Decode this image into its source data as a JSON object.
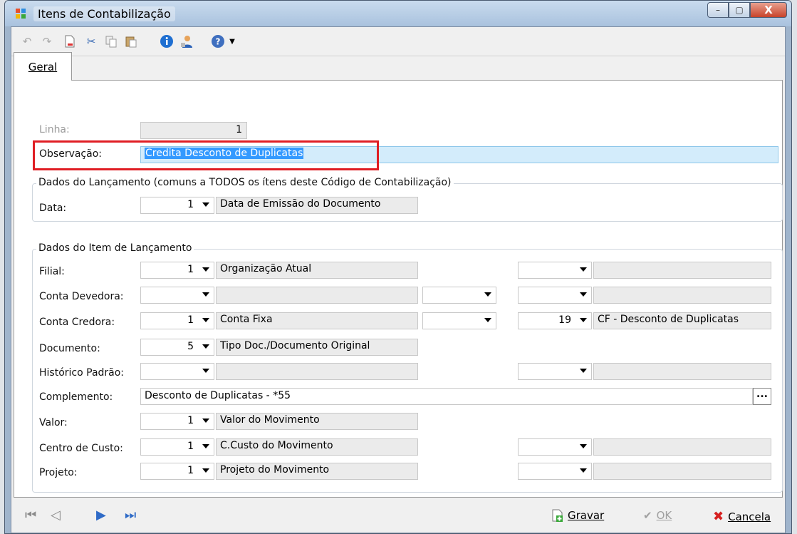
{
  "window": {
    "title": "Itens de Contabilização",
    "controls": {
      "minimize": "–",
      "maximize": "▢",
      "close": "X"
    }
  },
  "toolbar": {
    "icons": [
      "undo-icon",
      "redo-icon",
      "new-document-icon",
      "cut-icon",
      "copy-icon",
      "paste-icon",
      "info-icon",
      "user-icon",
      "help-icon",
      "dropdown-arrow-icon"
    ]
  },
  "tabs": [
    {
      "label": "Geral",
      "active": true
    }
  ],
  "form": {
    "linha": {
      "label": "Linha:",
      "value": "1"
    },
    "observacao": {
      "label": "Observação:",
      "value": "Credita Desconto de Duplicatas"
    },
    "group1": {
      "title": "Dados do Lançamento (comuns a TODOS os ítens deste Código de Contabilização)",
      "data": {
        "label": "Data:",
        "code": "1",
        "desc": "Data de Emissão do Documento"
      }
    },
    "group2": {
      "title": "Dados do Item de Lançamento",
      "filial": {
        "label": "Filial:",
        "code": "1",
        "desc": "Organização Atual",
        "code2": "",
        "desc2": ""
      },
      "conta_devedora": {
        "label": "Conta Devedora:",
        "code": "",
        "desc": "",
        "mid": "",
        "code2": "",
        "desc2": ""
      },
      "conta_credora": {
        "label": "Conta Credora:",
        "code": "1",
        "desc": "Conta Fixa",
        "mid": "",
        "code2": "19",
        "desc2": "CF - Desconto de Duplicatas"
      },
      "documento": {
        "label": "Documento:",
        "code": "5",
        "desc": "Tipo Doc./Documento Original"
      },
      "historico": {
        "label": "Histórico Padrão:",
        "code": "",
        "desc": "",
        "code2": "",
        "desc2": ""
      },
      "complemento": {
        "label": "Complemento:",
        "value": "Desconto de Duplicatas - *55",
        "button": "..."
      },
      "valor": {
        "label": "Valor:",
        "code": "1",
        "desc": "Valor do Movimento"
      },
      "centro_custo": {
        "label": "Centro de Custo:",
        "code": "1",
        "desc": "C.Custo do Movimento",
        "code2": "",
        "desc2": ""
      },
      "projeto": {
        "label": "Projeto:",
        "code": "1",
        "desc": "Projeto do Movimento",
        "code2": "",
        "desc2": ""
      }
    }
  },
  "actions": {
    "gravar": "Gravar",
    "ok": "OK",
    "cancela": "Cancela"
  },
  "colors": {
    "annotation": "#e01e24",
    "selection": "#3399ff",
    "nav": "#2f6bc7"
  }
}
